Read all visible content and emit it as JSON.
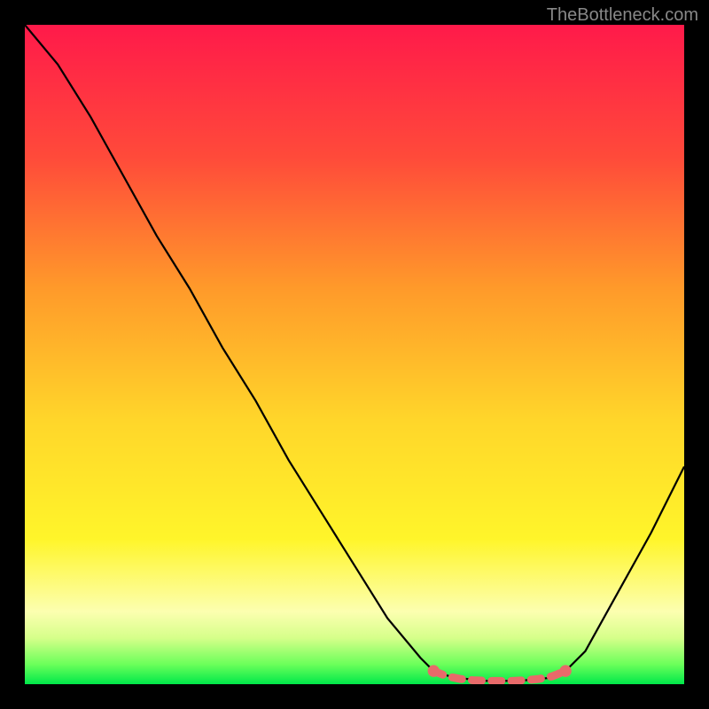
{
  "watermark": "TheBottleneck.com",
  "chart_data": {
    "type": "line",
    "title": "",
    "xlabel": "",
    "ylabel": "",
    "xlim": [
      0,
      100
    ],
    "ylim": [
      0,
      100
    ],
    "gradient_stops": [
      {
        "offset": 0,
        "color": "#ff1a4a"
      },
      {
        "offset": 20,
        "color": "#ff4a3a"
      },
      {
        "offset": 40,
        "color": "#ff9a2a"
      },
      {
        "offset": 60,
        "color": "#ffd62a"
      },
      {
        "offset": 78,
        "color": "#fff52a"
      },
      {
        "offset": 89,
        "color": "#fcffb0"
      },
      {
        "offset": 93,
        "color": "#d6ff8a"
      },
      {
        "offset": 97,
        "color": "#6bff5a"
      },
      {
        "offset": 100,
        "color": "#00e84a"
      }
    ],
    "series": [
      {
        "name": "bottleneck-curve",
        "color": "#000000",
        "x": [
          0,
          5,
          10,
          15,
          20,
          25,
          30,
          35,
          40,
          45,
          50,
          55,
          60,
          62,
          65,
          70,
          75,
          80,
          82,
          85,
          90,
          95,
          100
        ],
        "y": [
          100,
          94,
          86,
          77,
          68,
          60,
          51,
          43,
          34,
          26,
          18,
          10,
          4,
          2,
          1,
          0.5,
          0.5,
          1,
          2,
          5,
          14,
          23,
          33
        ]
      },
      {
        "name": "optimal-range-marker",
        "color": "#e86a6a",
        "x": [
          62,
          64,
          66,
          68,
          70,
          72,
          74,
          76,
          78,
          80,
          82
        ],
        "y": [
          2,
          1.2,
          0.8,
          0.6,
          0.5,
          0.5,
          0.5,
          0.6,
          0.8,
          1.2,
          2
        ]
      }
    ]
  }
}
